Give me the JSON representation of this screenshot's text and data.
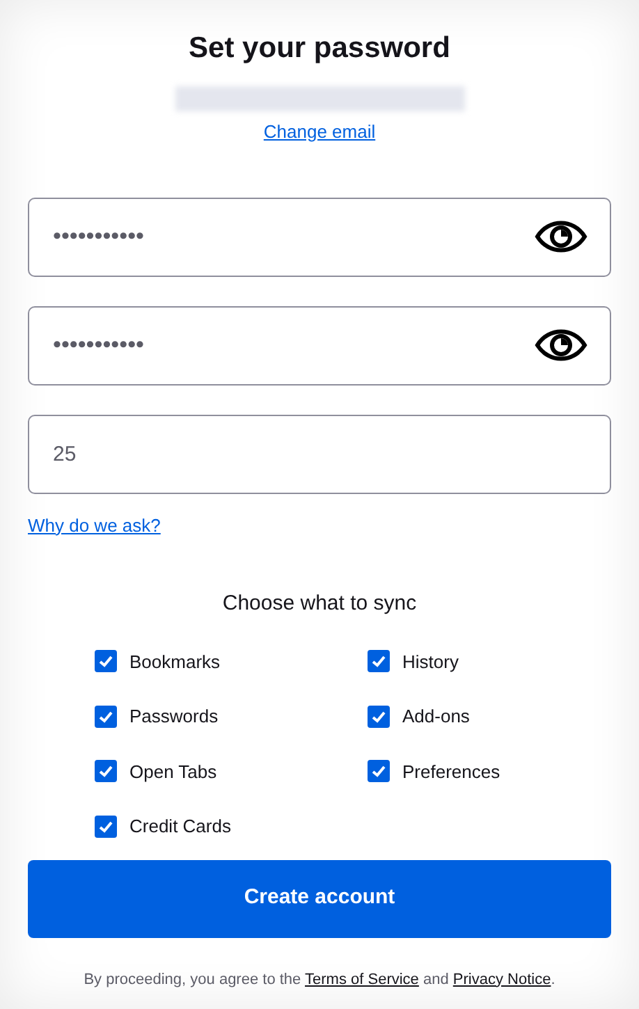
{
  "title": "Set your password",
  "change_email": "Change email",
  "fields": [
    {
      "kind": "password",
      "value": "•••••••••••"
    },
    {
      "kind": "password",
      "value": "•••••••••••"
    },
    {
      "kind": "text",
      "value": "25"
    }
  ],
  "why_link": "Why do we ask?",
  "sync": {
    "heading": "Choose what to sync",
    "items": [
      {
        "label": "Bookmarks",
        "checked": true
      },
      {
        "label": "History",
        "checked": true
      },
      {
        "label": "Passwords",
        "checked": true
      },
      {
        "label": "Add-ons",
        "checked": true
      },
      {
        "label": "Open Tabs",
        "checked": true
      },
      {
        "label": "Preferences",
        "checked": true
      },
      {
        "label": "Credit Cards",
        "checked": true
      }
    ]
  },
  "submit": "Create account",
  "legal": [
    {
      "kind": "text",
      "text": "By proceeding, you agree to the "
    },
    {
      "kind": "link",
      "text": "Terms of Service"
    },
    {
      "kind": "text",
      "text": " and "
    },
    {
      "kind": "link",
      "text": "Privacy Notice"
    },
    {
      "kind": "text",
      "text": "."
    }
  ]
}
